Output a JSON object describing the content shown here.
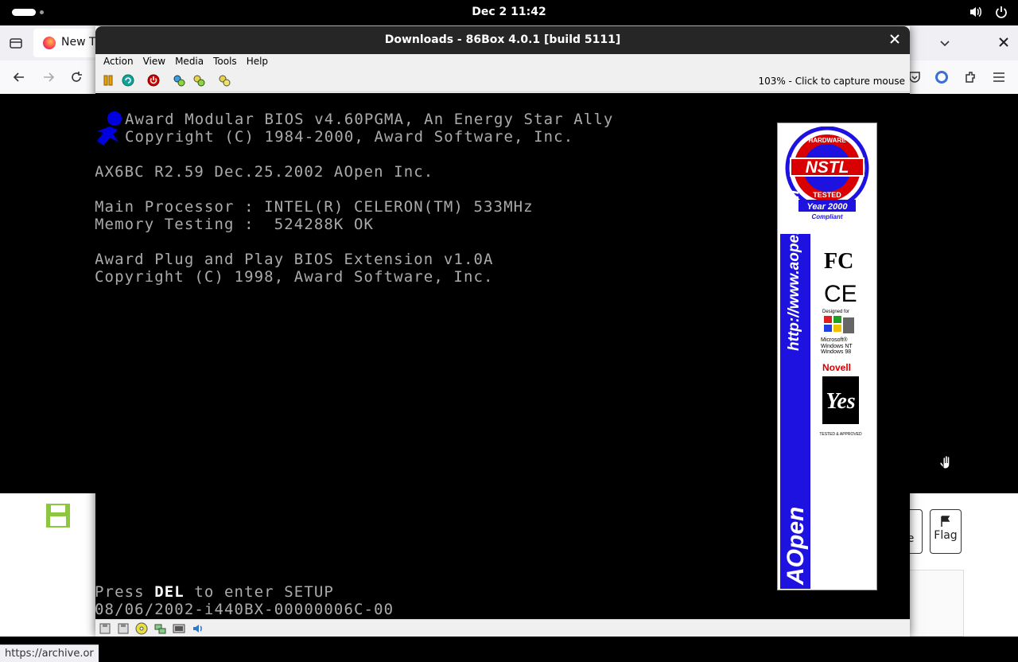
{
  "topbar": {
    "clock": "Dec 2  11:42",
    "icons": [
      "speaker-icon",
      "power-icon"
    ]
  },
  "firefox": {
    "tab_label": "New T",
    "content_buttons": {
      "flag": "Flag",
      "edit_partial": "e"
    },
    "status_url": "https://archive.or"
  },
  "box86": {
    "title": "Downloads - 86Box 4.0.1 [build 5111]",
    "menu": [
      "Action",
      "View",
      "Media",
      "Tools",
      "Help"
    ],
    "toolbar_hint": "103% - Click to capture mouse",
    "toolbar_icons": [
      "pause-icon",
      "ctrl-alt-del-icon",
      "power-icon",
      "settings-icon",
      "media-icon",
      "screenshot-icon"
    ],
    "status_icons": [
      "floppy-icon",
      "floppy2-icon",
      "cdrom-icon",
      "network-icon",
      "display-icon",
      "sound-icon"
    ]
  },
  "bios": {
    "line1": "Award Modular BIOS v4.60PGMA, An Energy Star Ally",
    "line2": "Copyright (C) 1984-2000, Award Software, Inc.",
    "board": "AX6BC R2.59 Dec.25.2002 AOpen Inc.",
    "cpu": "Main Processor : INTEL(R) CELERON(TM) 533MHz",
    "mem": "Memory Testing :  524288K OK",
    "pnp1": "Award Plug and Play BIOS Extension v1.0A",
    "pnp2": "Copyright (C) 1998, Award Software, Inc.",
    "press_pre": "Press ",
    "press_key": "DEL",
    "press_post": " to enter SETUP",
    "bios_id": "08/06/2002-i440BX-00000006C-00"
  },
  "banner": {
    "url": "http://www.aopen.com",
    "nstl_top": "HARDWARE",
    "nstl_main": "NSTL",
    "nstl_bottom": "TESTED",
    "year2000": "Year 2000",
    "compliant": "Compliant",
    "fc": "FC",
    "ce": "CE",
    "designed_for": "Designed for",
    "microsoft": "Microsoft®",
    "windows_nt": "Windows NT",
    "windows_98": "Windows 98",
    "novell": "Novell",
    "yes": "Yes",
    "tested_approved": "TESTED & APPROVED",
    "aopen": "AOpen"
  }
}
